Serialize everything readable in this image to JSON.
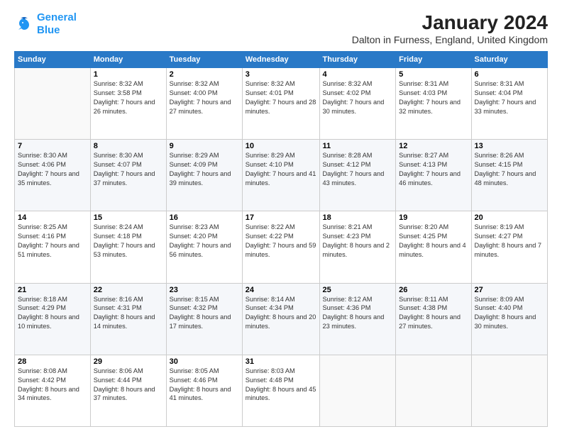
{
  "logo": {
    "line1": "General",
    "line2": "Blue"
  },
  "title": "January 2024",
  "subtitle": "Dalton in Furness, England, United Kingdom",
  "headers": [
    "Sunday",
    "Monday",
    "Tuesday",
    "Wednesday",
    "Thursday",
    "Friday",
    "Saturday"
  ],
  "weeks": [
    [
      {
        "day": "",
        "sunrise": "",
        "sunset": "",
        "daylight": ""
      },
      {
        "day": "1",
        "sunrise": "Sunrise: 8:32 AM",
        "sunset": "Sunset: 3:58 PM",
        "daylight": "Daylight: 7 hours and 26 minutes."
      },
      {
        "day": "2",
        "sunrise": "Sunrise: 8:32 AM",
        "sunset": "Sunset: 4:00 PM",
        "daylight": "Daylight: 7 hours and 27 minutes."
      },
      {
        "day": "3",
        "sunrise": "Sunrise: 8:32 AM",
        "sunset": "Sunset: 4:01 PM",
        "daylight": "Daylight: 7 hours and 28 minutes."
      },
      {
        "day": "4",
        "sunrise": "Sunrise: 8:32 AM",
        "sunset": "Sunset: 4:02 PM",
        "daylight": "Daylight: 7 hours and 30 minutes."
      },
      {
        "day": "5",
        "sunrise": "Sunrise: 8:31 AM",
        "sunset": "Sunset: 4:03 PM",
        "daylight": "Daylight: 7 hours and 32 minutes."
      },
      {
        "day": "6",
        "sunrise": "Sunrise: 8:31 AM",
        "sunset": "Sunset: 4:04 PM",
        "daylight": "Daylight: 7 hours and 33 minutes."
      }
    ],
    [
      {
        "day": "7",
        "sunrise": "Sunrise: 8:30 AM",
        "sunset": "Sunset: 4:06 PM",
        "daylight": "Daylight: 7 hours and 35 minutes."
      },
      {
        "day": "8",
        "sunrise": "Sunrise: 8:30 AM",
        "sunset": "Sunset: 4:07 PM",
        "daylight": "Daylight: 7 hours and 37 minutes."
      },
      {
        "day": "9",
        "sunrise": "Sunrise: 8:29 AM",
        "sunset": "Sunset: 4:09 PM",
        "daylight": "Daylight: 7 hours and 39 minutes."
      },
      {
        "day": "10",
        "sunrise": "Sunrise: 8:29 AM",
        "sunset": "Sunset: 4:10 PM",
        "daylight": "Daylight: 7 hours and 41 minutes."
      },
      {
        "day": "11",
        "sunrise": "Sunrise: 8:28 AM",
        "sunset": "Sunset: 4:12 PM",
        "daylight": "Daylight: 7 hours and 43 minutes."
      },
      {
        "day": "12",
        "sunrise": "Sunrise: 8:27 AM",
        "sunset": "Sunset: 4:13 PM",
        "daylight": "Daylight: 7 hours and 46 minutes."
      },
      {
        "day": "13",
        "sunrise": "Sunrise: 8:26 AM",
        "sunset": "Sunset: 4:15 PM",
        "daylight": "Daylight: 7 hours and 48 minutes."
      }
    ],
    [
      {
        "day": "14",
        "sunrise": "Sunrise: 8:25 AM",
        "sunset": "Sunset: 4:16 PM",
        "daylight": "Daylight: 7 hours and 51 minutes."
      },
      {
        "day": "15",
        "sunrise": "Sunrise: 8:24 AM",
        "sunset": "Sunset: 4:18 PM",
        "daylight": "Daylight: 7 hours and 53 minutes."
      },
      {
        "day": "16",
        "sunrise": "Sunrise: 8:23 AM",
        "sunset": "Sunset: 4:20 PM",
        "daylight": "Daylight: 7 hours and 56 minutes."
      },
      {
        "day": "17",
        "sunrise": "Sunrise: 8:22 AM",
        "sunset": "Sunset: 4:22 PM",
        "daylight": "Daylight: 7 hours and 59 minutes."
      },
      {
        "day": "18",
        "sunrise": "Sunrise: 8:21 AM",
        "sunset": "Sunset: 4:23 PM",
        "daylight": "Daylight: 8 hours and 2 minutes."
      },
      {
        "day": "19",
        "sunrise": "Sunrise: 8:20 AM",
        "sunset": "Sunset: 4:25 PM",
        "daylight": "Daylight: 8 hours and 4 minutes."
      },
      {
        "day": "20",
        "sunrise": "Sunrise: 8:19 AM",
        "sunset": "Sunset: 4:27 PM",
        "daylight": "Daylight: 8 hours and 7 minutes."
      }
    ],
    [
      {
        "day": "21",
        "sunrise": "Sunrise: 8:18 AM",
        "sunset": "Sunset: 4:29 PM",
        "daylight": "Daylight: 8 hours and 10 minutes."
      },
      {
        "day": "22",
        "sunrise": "Sunrise: 8:16 AM",
        "sunset": "Sunset: 4:31 PM",
        "daylight": "Daylight: 8 hours and 14 minutes."
      },
      {
        "day": "23",
        "sunrise": "Sunrise: 8:15 AM",
        "sunset": "Sunset: 4:32 PM",
        "daylight": "Daylight: 8 hours and 17 minutes."
      },
      {
        "day": "24",
        "sunrise": "Sunrise: 8:14 AM",
        "sunset": "Sunset: 4:34 PM",
        "daylight": "Daylight: 8 hours and 20 minutes."
      },
      {
        "day": "25",
        "sunrise": "Sunrise: 8:12 AM",
        "sunset": "Sunset: 4:36 PM",
        "daylight": "Daylight: 8 hours and 23 minutes."
      },
      {
        "day": "26",
        "sunrise": "Sunrise: 8:11 AM",
        "sunset": "Sunset: 4:38 PM",
        "daylight": "Daylight: 8 hours and 27 minutes."
      },
      {
        "day": "27",
        "sunrise": "Sunrise: 8:09 AM",
        "sunset": "Sunset: 4:40 PM",
        "daylight": "Daylight: 8 hours and 30 minutes."
      }
    ],
    [
      {
        "day": "28",
        "sunrise": "Sunrise: 8:08 AM",
        "sunset": "Sunset: 4:42 PM",
        "daylight": "Daylight: 8 hours and 34 minutes."
      },
      {
        "day": "29",
        "sunrise": "Sunrise: 8:06 AM",
        "sunset": "Sunset: 4:44 PM",
        "daylight": "Daylight: 8 hours and 37 minutes."
      },
      {
        "day": "30",
        "sunrise": "Sunrise: 8:05 AM",
        "sunset": "Sunset: 4:46 PM",
        "daylight": "Daylight: 8 hours and 41 minutes."
      },
      {
        "day": "31",
        "sunrise": "Sunrise: 8:03 AM",
        "sunset": "Sunset: 4:48 PM",
        "daylight": "Daylight: 8 hours and 45 minutes."
      },
      {
        "day": "",
        "sunrise": "",
        "sunset": "",
        "daylight": ""
      },
      {
        "day": "",
        "sunrise": "",
        "sunset": "",
        "daylight": ""
      },
      {
        "day": "",
        "sunrise": "",
        "sunset": "",
        "daylight": ""
      }
    ]
  ]
}
